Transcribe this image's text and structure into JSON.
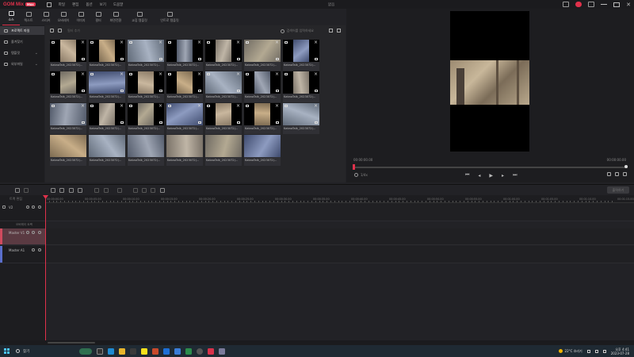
{
  "app": {
    "logo": "GOM Mix",
    "badge": "Max",
    "menu": [
      "파일",
      "편집",
      "옵션",
      "보기",
      "도움말"
    ],
    "doc_title": "없음"
  },
  "tool_tabs": [
    {
      "label": "소스",
      "icon": "folder-icon",
      "active": true
    },
    {
      "label": "텍스트",
      "icon": "text-icon"
    },
    {
      "label": "스티커",
      "icon": "sticker-icon"
    },
    {
      "label": "오버레이",
      "icon": "overlay-icon"
    },
    {
      "label": "이미지",
      "icon": "image-icon"
    },
    {
      "label": "필터",
      "icon": "filter-icon"
    },
    {
      "label": "화면전환",
      "icon": "transition-icon"
    },
    {
      "label": "교집 템플릿",
      "icon": "template-icon"
    },
    {
      "label": "인트로 템플릿",
      "icon": "intro-template-icon"
    }
  ],
  "sidebar": {
    "items": [
      {
        "label": "프로젝트 파일",
        "active": true
      },
      {
        "label": "즐겨찾기"
      },
      {
        "label": "템플릿",
        "chevron": "⌄"
      },
      {
        "label": "외부파일",
        "chevron": "⌄"
      }
    ]
  },
  "media": {
    "filter_placeholder": "필터 추가",
    "search_placeholder": "검색어를 입력하세요",
    "items": [
      "KakaoTalk_2023072(...",
      "KakaoTalk_2023072(...",
      "KakaoTalk_2023072(...",
      "KakaoTalk_2023072(...",
      "KakaoTalk_2023072(...",
      "KakaoTalk_2023072(...",
      "KakaoTalk_2023072(...",
      "KakaoTalk_2023072(...",
      "KakaoTalk_2023072(...",
      "KakaoTalk_2023072(...",
      "KakaoTalk_2023072(...",
      "KakaoTalk_2023072(...",
      "KakaoTalk_2023072(...",
      "KakaoTalk_2023072(...",
      "KakaoTalk_2023072(...",
      "KakaoTalk_2023072(...",
      "KakaoTalk_2023072(...",
      "KakaoTalk_2023072(...",
      "KakaoTalk_2023072(...",
      "KakaoTalk_2023072(...",
      "KakaoTalk_2023072(...",
      "KakaoTalk_2023072(...",
      "KakaoTalk_2023072(...",
      "KakaoTalk_2023072(...",
      "KakaoTalk_2023072(...",
      "KakaoTalk_2023072(...",
      "KakaoTalk_2023072(..."
    ]
  },
  "preview": {
    "time_current": "00:00:00.00",
    "time_total": "00:00:00.00",
    "zoom_label": "1/4x"
  },
  "timeline": {
    "head_label": "트랙 편집",
    "ruler": [
      "00:00:00.00",
      "00:00:05.00",
      "00:00:10.00",
      "00:00:15.00",
      "00:00:20.00",
      "00:00:25.00",
      "00:00:30.00",
      "00:00:35.00",
      "00:00:40.00",
      "00:00:45.00",
      "00:00:50.00",
      "00:00:55.00",
      "00:01:00.00",
      "00:01:05.00",
      "00:01:10.00",
      "00:01:15.00"
    ],
    "tracks": {
      "t1": "V2",
      "sub": "오버레이 트랙",
      "v1": "Master V1",
      "a1": "Master A1"
    },
    "export_label": "출력하기"
  },
  "taskbar": {
    "search_placeholder": "찾기",
    "weather": "22°C 흐리기",
    "time": "오후 4:41",
    "date": "2023-07-28"
  }
}
